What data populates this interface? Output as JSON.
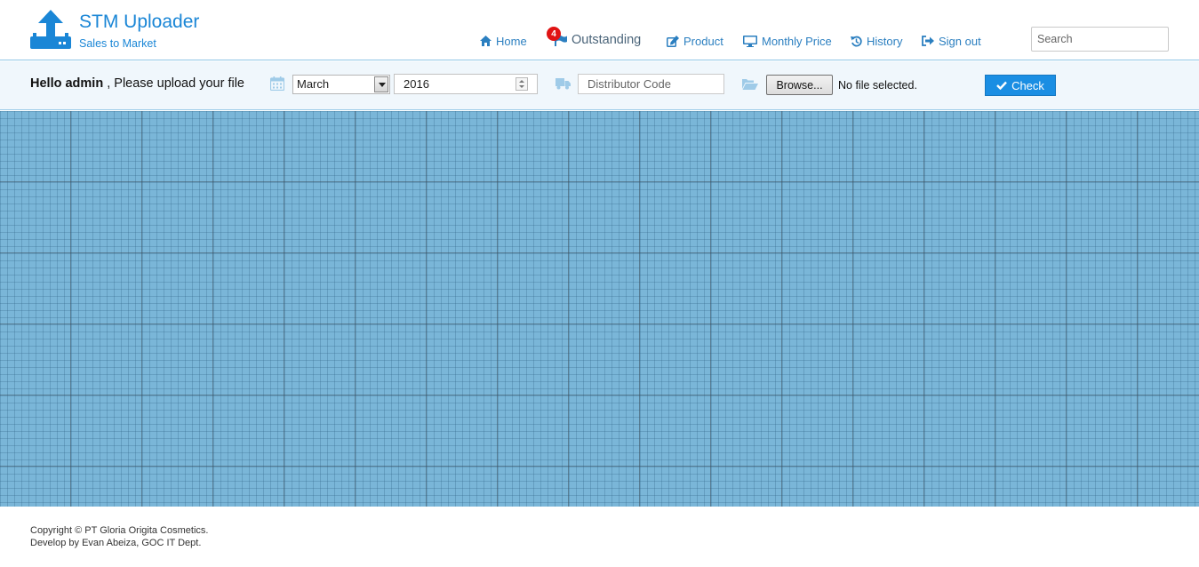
{
  "app": {
    "title": "STM Uploader",
    "subtitle": "Sales to Market",
    "logo_icon": "upload-tray-icon"
  },
  "nav": {
    "items": [
      {
        "label": "Home",
        "icon": "home-icon"
      },
      {
        "label": "Outstanding",
        "icon": "flag-icon",
        "badge": "4"
      },
      {
        "label": "Product",
        "icon": "edit-icon"
      },
      {
        "label": "Monthly Price",
        "icon": "monitor-icon"
      },
      {
        "label": "History",
        "icon": "history-icon"
      },
      {
        "label": "Sign out",
        "icon": "sign-out-icon"
      }
    ],
    "search_placeholder": "Search"
  },
  "upload": {
    "greeting_user": "Hello admin",
    "greeting_rest": " , Please upload your file",
    "month": "March",
    "year": "2016",
    "distributor_placeholder": "Distributor Code",
    "browse_label": "Browse...",
    "file_status": "No file selected.",
    "check_label": "Check"
  },
  "footer": {
    "line1": "Copyright © PT Gloria Origita Cosmetics.",
    "line2": "Develop by Evan Abeiza, GOC IT Dept."
  },
  "colors": {
    "brand": "#1a86d6",
    "nav_text": "#2b7fc0",
    "badge": "#e01313",
    "check_button": "#1a8ee3",
    "grid_background": "#7ab6d8",
    "bar_background": "#f0f7fc"
  }
}
